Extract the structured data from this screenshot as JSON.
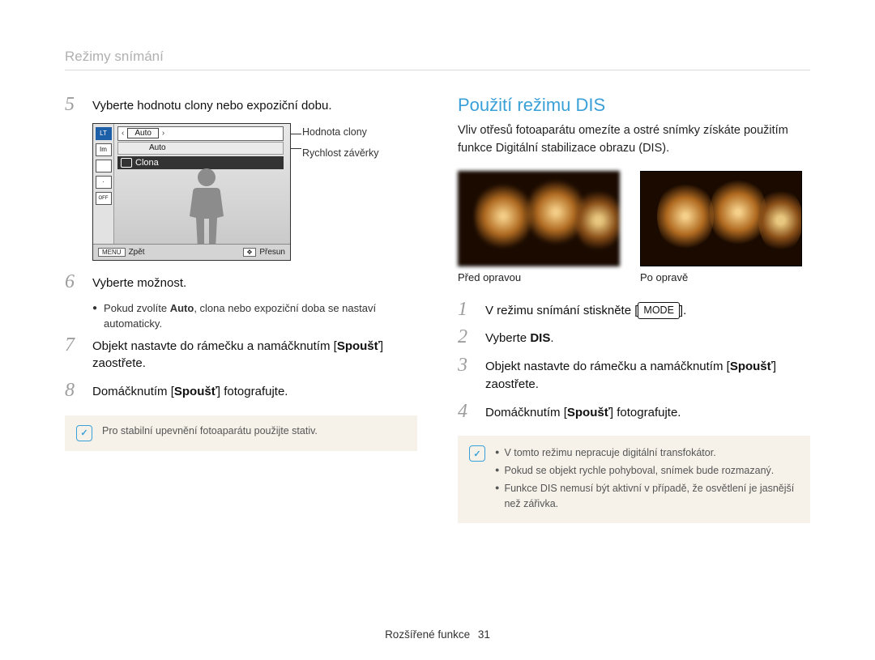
{
  "page": {
    "section": "Režimy snímání",
    "footer_label": "Rozšířené funkce",
    "footer_page": "31"
  },
  "left": {
    "step5": "Vyberte hodnotu clony nebo expoziční dobu.",
    "lcd": {
      "mode_icon": "LT",
      "row2_icon": "Im",
      "auto1": "Auto",
      "auto2": "Auto",
      "clona": "Clona",
      "back_key": "MENU",
      "back_label": "Zpět",
      "move_label": "Přesun"
    },
    "anno": {
      "aperture": "Hodnota clony",
      "shutter": "Rychlost závěrky"
    },
    "step6": "Vyberte možnost.",
    "step6_note_pre": "Pokud zvolíte ",
    "step6_note_bold": "Auto",
    "step6_note_post": ", clona nebo expoziční doba se nastaví automaticky.",
    "step7_pre": "Objekt nastavte do rámečku a namáčknutím [",
    "step7_bold": "Spoušť",
    "step7_post": "] zaostřete.",
    "step8_pre": "Domáčknutím [",
    "step8_bold": "Spoušť",
    "step8_post": "] fotografujte.",
    "note": "Pro stabilní upevnění fotoaparátu použijte stativ."
  },
  "right": {
    "heading": "Použití režimu DIS",
    "intro": "Vliv otřesů fotoaparátu omezíte a ostré snímky získáte použitím funkce Digitální stabilizace obrazu (DIS).",
    "cap_before": "Před opravou",
    "cap_after": "Po opravě",
    "step1_pre": "V režimu snímání stiskněte [",
    "step1_mode": "MODE",
    "step1_post": "].",
    "step2_pre": "Vyberte ",
    "step2_bold": "DIS",
    "step2_post": ".",
    "step3_pre": "Objekt nastavte do rámečku a namáčknutím [",
    "step3_bold": "Spoušť",
    "step3_post": "] zaostřete.",
    "step4_pre": "Domáčknutím [",
    "step4_bold": "Spoušť",
    "step4_post": "] fotografujte.",
    "notes": {
      "n1": "V tomto režimu nepracuje digitální transfokátor.",
      "n2": "Pokud se objekt rychle pohyboval, snímek bude rozmazaný.",
      "n3": "Funkce DIS nemusí být aktivní v případě, že osvětlení je jasnější než zářivka."
    }
  }
}
